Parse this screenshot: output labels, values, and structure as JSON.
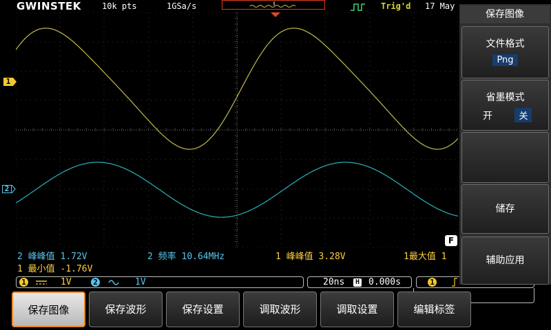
{
  "topbar": {
    "logo": "GWINSTEK",
    "record_length": "10k pts",
    "sample_rate": "1GSa/s",
    "trigger_status": "Trig'd",
    "date": "17 May"
  },
  "channels": {
    "ch1_marker": "1",
    "ch2_marker": "2",
    "ch1_color": "#b8b04a",
    "ch2_color": "#2aa6b0"
  },
  "measurements": {
    "row1": [
      {
        "ch": "2",
        "label": "峰峰值",
        "value": "1.72V"
      },
      {
        "ch": "2",
        "label": "频率",
        "value": "10.64MHz"
      },
      {
        "ch": "1",
        "label": "峰峰值",
        "value": "3.28V"
      },
      {
        "ch": "1",
        "label": "最大值",
        "value": "1"
      }
    ],
    "row2": [
      {
        "ch": "1",
        "label": "最小值",
        "value": "-1.76V"
      }
    ]
  },
  "status": {
    "ch1": "1",
    "ch1_coupling_icon": "dc-coupling-icon",
    "ch1_scale": "1V",
    "ch2": "2",
    "ch2_coupling_icon": "ac-coupling-icon",
    "ch2_scale": "1V",
    "timebase": "20ns",
    "horizontal_position": "0.000s",
    "trigger_source": "1"
  },
  "side_menu": {
    "title": "保存图像",
    "file_format_label": "文件格式",
    "file_format_value": "Png",
    "ink_saver_label": "省墨模式",
    "ink_saver_on": "开",
    "ink_saver_off": "关",
    "save_label": "储存",
    "assist_label": "辅助应用"
  },
  "softkeys": [
    "保存图像",
    "保存波形",
    "保存设置",
    "调取波形",
    "调取设置",
    "编辑标签"
  ],
  "f_marker": "F"
}
